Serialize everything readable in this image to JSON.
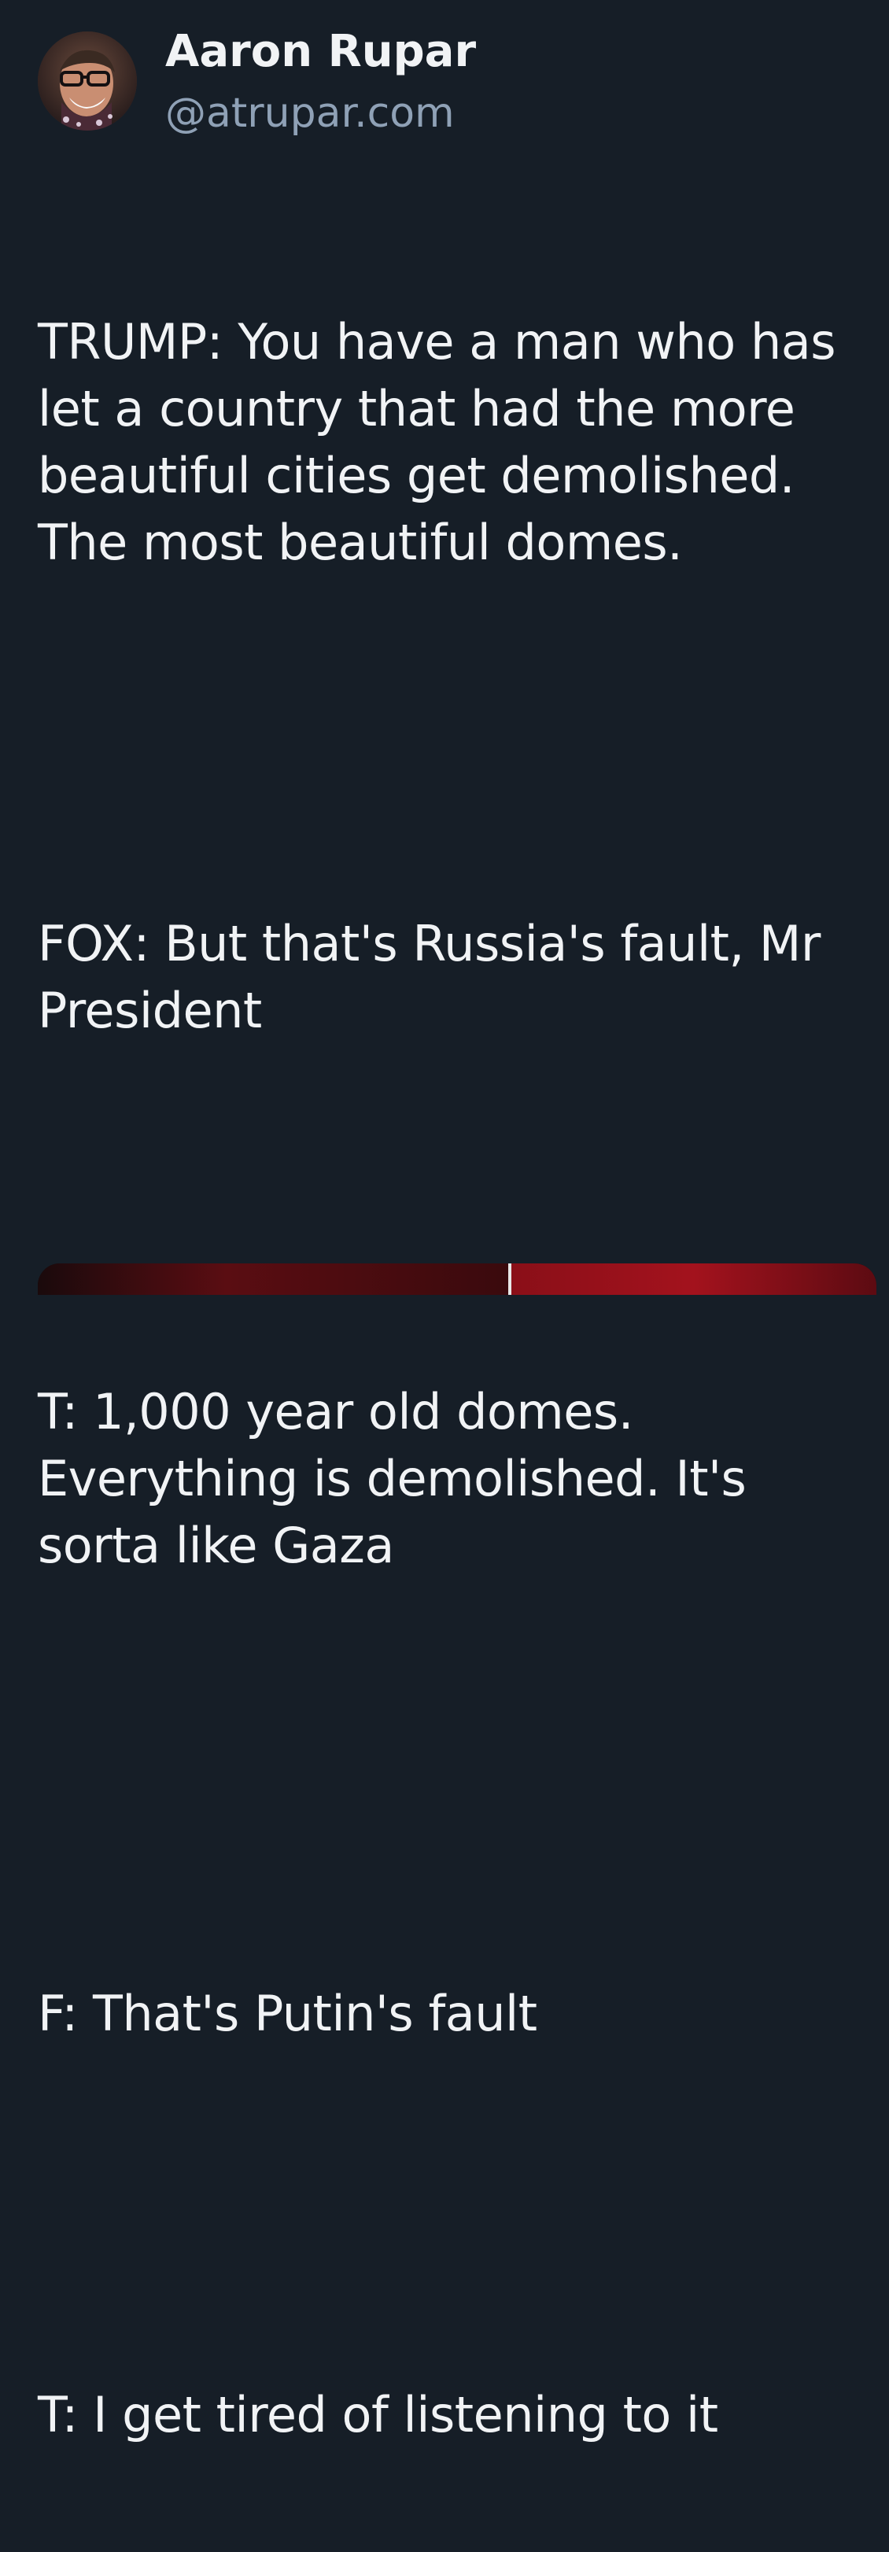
{
  "author": {
    "name": "Aaron Rupar",
    "handle": "@atrupar.com",
    "avatar_icon": "user-avatar-photo"
  },
  "post": {
    "paragraphs": [
      "TRUMP: You have a man who has let a country that had the more beautiful cities get demolished. The most beautiful domes.",
      "FOX: But that's Russia's fault, Mr President",
      "T: 1,000 year old domes. Everything is demolished. It's sorta like Gaza",
      "F: That's Putin's fault",
      "T: I get tired of listening to it"
    ]
  },
  "colors": {
    "background": "#161e27",
    "text": "#f1f3f5",
    "handle": "#8fa1b6"
  }
}
